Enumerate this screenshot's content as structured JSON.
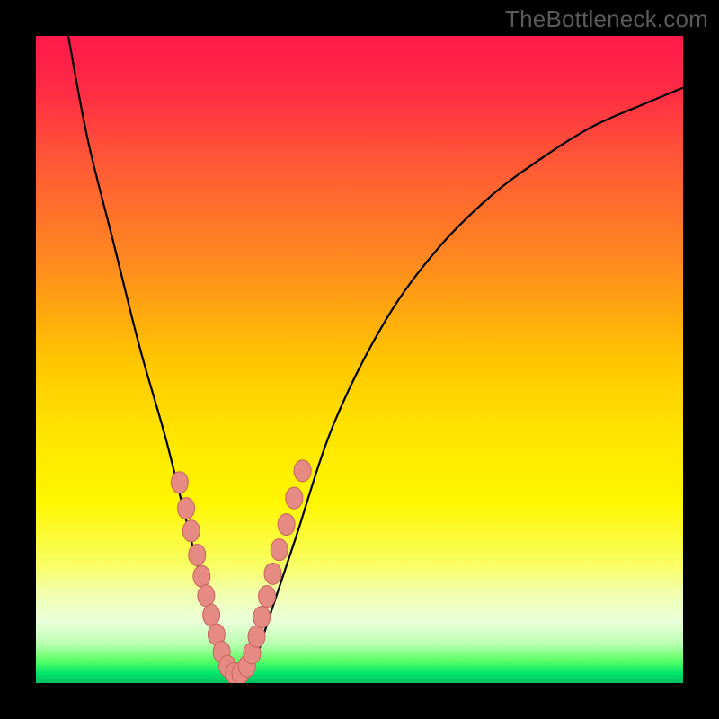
{
  "watermark": "TheBottleneck.com",
  "colors": {
    "frame": "#000000",
    "gradient_stops": [
      {
        "offset": 0.0,
        "color": "#ff1a4b"
      },
      {
        "offset": 0.08,
        "color": "#ff2a45"
      },
      {
        "offset": 0.2,
        "color": "#ff5a36"
      },
      {
        "offset": 0.35,
        "color": "#ff8a1f"
      },
      {
        "offset": 0.5,
        "color": "#ffc500"
      },
      {
        "offset": 0.62,
        "color": "#ffe600"
      },
      {
        "offset": 0.72,
        "color": "#fff600"
      },
      {
        "offset": 0.82,
        "color": "#f9ff66"
      },
      {
        "offset": 0.86,
        "color": "#f2ffad"
      },
      {
        "offset": 0.905,
        "color": "#eaffda"
      },
      {
        "offset": 0.94,
        "color": "#b9ffb0"
      },
      {
        "offset": 0.965,
        "color": "#5cff66"
      },
      {
        "offset": 0.985,
        "color": "#00e66a"
      },
      {
        "offset": 1.0,
        "color": "#00c060"
      }
    ],
    "curve": "#000000",
    "dot_fill": "#e58b84",
    "dot_stroke": "#c9615c"
  },
  "chart_data": {
    "type": "line",
    "title": "",
    "xlabel": "",
    "ylabel": "",
    "xlim": [
      0,
      100
    ],
    "ylim": [
      0,
      100
    ],
    "series": [
      {
        "name": "bottleneck-curve",
        "x": [
          5,
          8,
          12,
          16,
          20,
          23,
          25,
          27,
          29,
          30.5,
          32,
          34,
          36,
          40,
          46,
          54,
          62,
          70,
          78,
          86,
          94,
          100
        ],
        "y": [
          100,
          84,
          68,
          52,
          38,
          26,
          18,
          10,
          4,
          1.5,
          1.5,
          4,
          10,
          22,
          40,
          56,
          67,
          75,
          81,
          86,
          89.5,
          92
        ]
      }
    ],
    "dots": {
      "name": "highlight-dots",
      "x": [
        22.2,
        23.2,
        24.0,
        24.9,
        25.6,
        26.3,
        27.1,
        27.9,
        28.7,
        29.6,
        30.6,
        31.6,
        32.6,
        33.4,
        34.1,
        34.9,
        35.7,
        36.6,
        37.6,
        38.7,
        39.9,
        41.2
      ],
      "y": [
        31.0,
        27.0,
        23.5,
        19.8,
        16.5,
        13.5,
        10.5,
        7.5,
        4.8,
        2.6,
        1.5,
        1.5,
        2.6,
        4.6,
        7.2,
        10.2,
        13.4,
        16.9,
        20.6,
        24.5,
        28.6,
        32.8
      ]
    }
  }
}
